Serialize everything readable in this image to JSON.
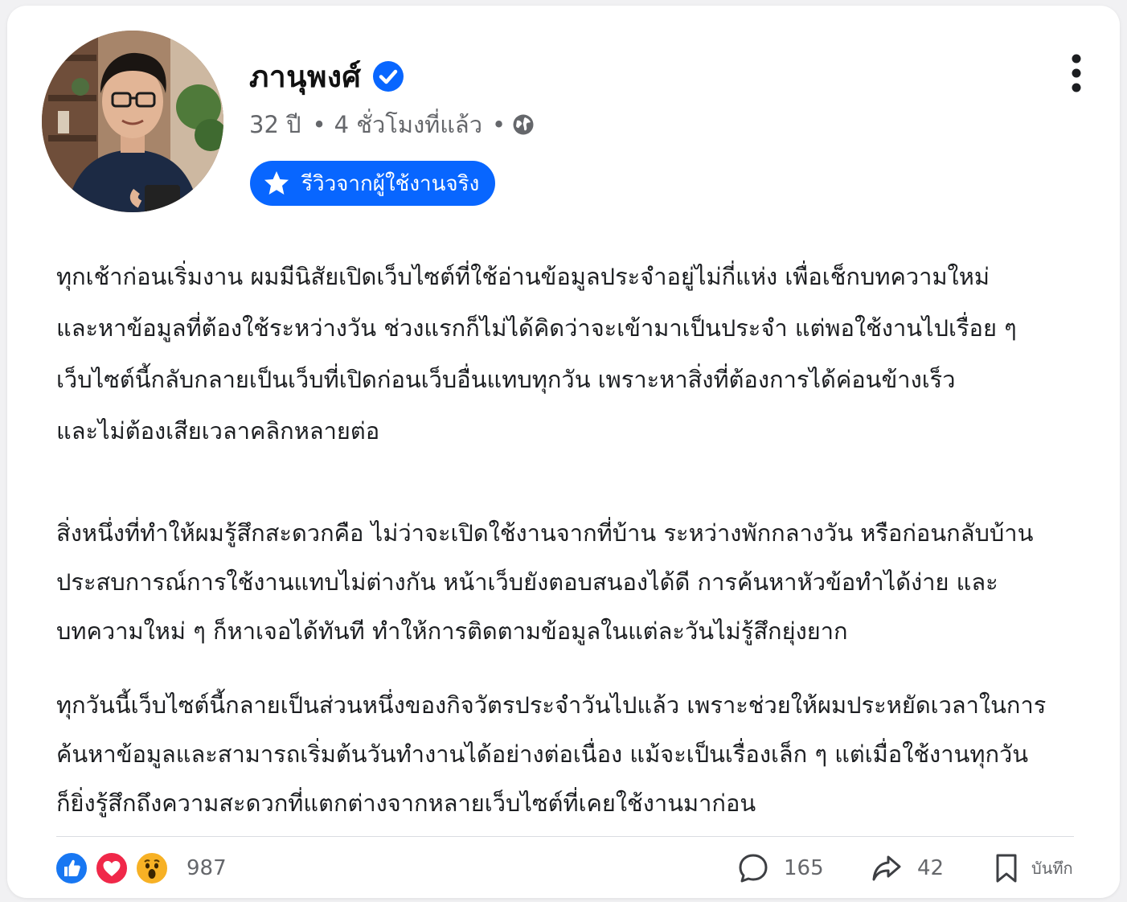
{
  "author": {
    "name": "ภานุพงศ์",
    "verified": true
  },
  "meta": {
    "age": "32 ปี",
    "separator": "•",
    "time": "4 ชั่วโมงที่แล้ว",
    "privacy_icon": "globe-icon"
  },
  "badge": {
    "icon": "star-icon",
    "label": "รีวิวจากผู้ใช้งานจริง"
  },
  "post": {
    "paragraphs": [
      "ทุกเช้าก่อนเริ่มงาน ผมมีนิสัยเปิดเว็บไซต์ที่ใช้อ่านข้อมูลประจำอยู่ไม่กี่แห่ง เพื่อเช็กบทความใหม่และหาข้อมูลที่ต้องใช้ระหว่างวัน ช่วงแรกก็ไม่ได้คิดว่าจะเข้ามาเป็นประจำ แต่พอใช้งานไปเรื่อย ๆ เว็บไซต์นี้กลับกลายเป็นเว็บที่เปิดก่อนเว็บอื่นแทบทุกวัน เพราะหาสิ่งที่ต้องการได้ค่อนข้างเร็ว และไม่ต้องเสียเวลาคลิกหลายต่อ",
      "สิ่งหนึ่งที่ทำให้ผมรู้สึกสะดวกคือ ไม่ว่าจะเปิดใช้งานจากที่บ้าน ระหว่างพักกลางวัน หรือก่อนกลับบ้าน ประสบการณ์การใช้งานแทบไม่ต่างกัน หน้าเว็บยังตอบสนองได้ดี การค้นหาหัวข้อทำได้ง่าย และบทความใหม่ ๆ ก็หาเจอได้ทันที ทำให้การติดตามข้อมูลในแต่ละวันไม่รู้สึกยุ่งยาก",
      "ทุกวันนี้เว็บไซต์นี้กลายเป็นส่วนหนึ่งของกิจวัตรประจำวันไปแล้ว เพราะช่วยให้ผมประหยัดเวลาในการค้นหาข้อมูลและสามารถเริ่มต้นวันทำงานได้อย่างต่อเนื่อง แม้จะเป็นเรื่องเล็ก ๆ แต่เมื่อใช้งานทุกวัน ก็ยิ่งรู้สึกถึงความสะดวกที่แตกต่างจากหลายเว็บไซต์ที่เคยใช้งานมาก่อน"
    ],
    "lines": [
      [
        "ทุกเช้าก่อนเริ่มงาน ผมมีนิสัยเปิดเว็บไซต์ที่ใช้อ่านข้อมูลประจำอยู่ไม่กี่แห่ง เพื่อเช็กบทความใหม่",
        "และหาข้อมูลที่ต้องใช้ระหว่างวัน ช่วงแรกก็ไม่ได้คิดว่าจะเข้ามาเป็นประจำ แต่พอใช้งานไปเรื่อย ๆ",
        "เว็บไซต์นี้กลับกลายเป็นเว็บที่เปิดก่อนเว็บอื่นแทบทุกวัน เพราะหาสิ่งที่ต้องการได้ค่อนข้างเร็ว",
        "และไม่ต้องเสียเวลาคลิกหลายต่อ"
      ],
      [
        "สิ่งหนึ่งที่ทำให้ผมรู้สึกสะดวกคือ ไม่ว่าจะเปิดใช้งานจากที่บ้าน ระหว่างพักกลางวัน หรือก่อนกลับบ้าน",
        "ประสบการณ์การใช้งานแทบไม่ต่างกัน หน้าเว็บยังตอบสนองได้ดี การค้นหาหัวข้อทำได้ง่าย และ",
        "บทความใหม่ ๆ ก็หาเจอได้ทันที ทำให้การติดตามข้อมูลในแต่ละวันไม่รู้สึกยุ่งยาก"
      ],
      [
        "ทุกวันนี้เว็บไซต์นี้กลายเป็นส่วนหนึ่งของกิจวัตรประจำวันไปแล้ว เพราะช่วยให้ผมประหยัดเวลาในการ",
        "ค้นหาข้อมูลและสามารถเริ่มต้นวันทำงานได้อย่างต่อเนื่อง แม้จะเป็นเรื่องเล็ก ๆ แต่เมื่อใช้งานทุกวัน",
        "ก็ยิ่งรู้สึกถึงความสะดวกที่แตกต่างจากหลายเว็บไซต์ที่เคยใช้งานมาก่อน"
      ]
    ]
  },
  "reactions": {
    "icons": [
      "like-icon",
      "love-icon",
      "wow-icon"
    ],
    "count": "987"
  },
  "actions": {
    "comments": "165",
    "shares": "42",
    "save_label": "บันทึก"
  },
  "colors": {
    "accent": "#0866ff",
    "like": "#1877f2",
    "love": "#f02849",
    "wow": "#f7b125",
    "muted_text": "#65676b",
    "body_text": "#1c1e21"
  }
}
